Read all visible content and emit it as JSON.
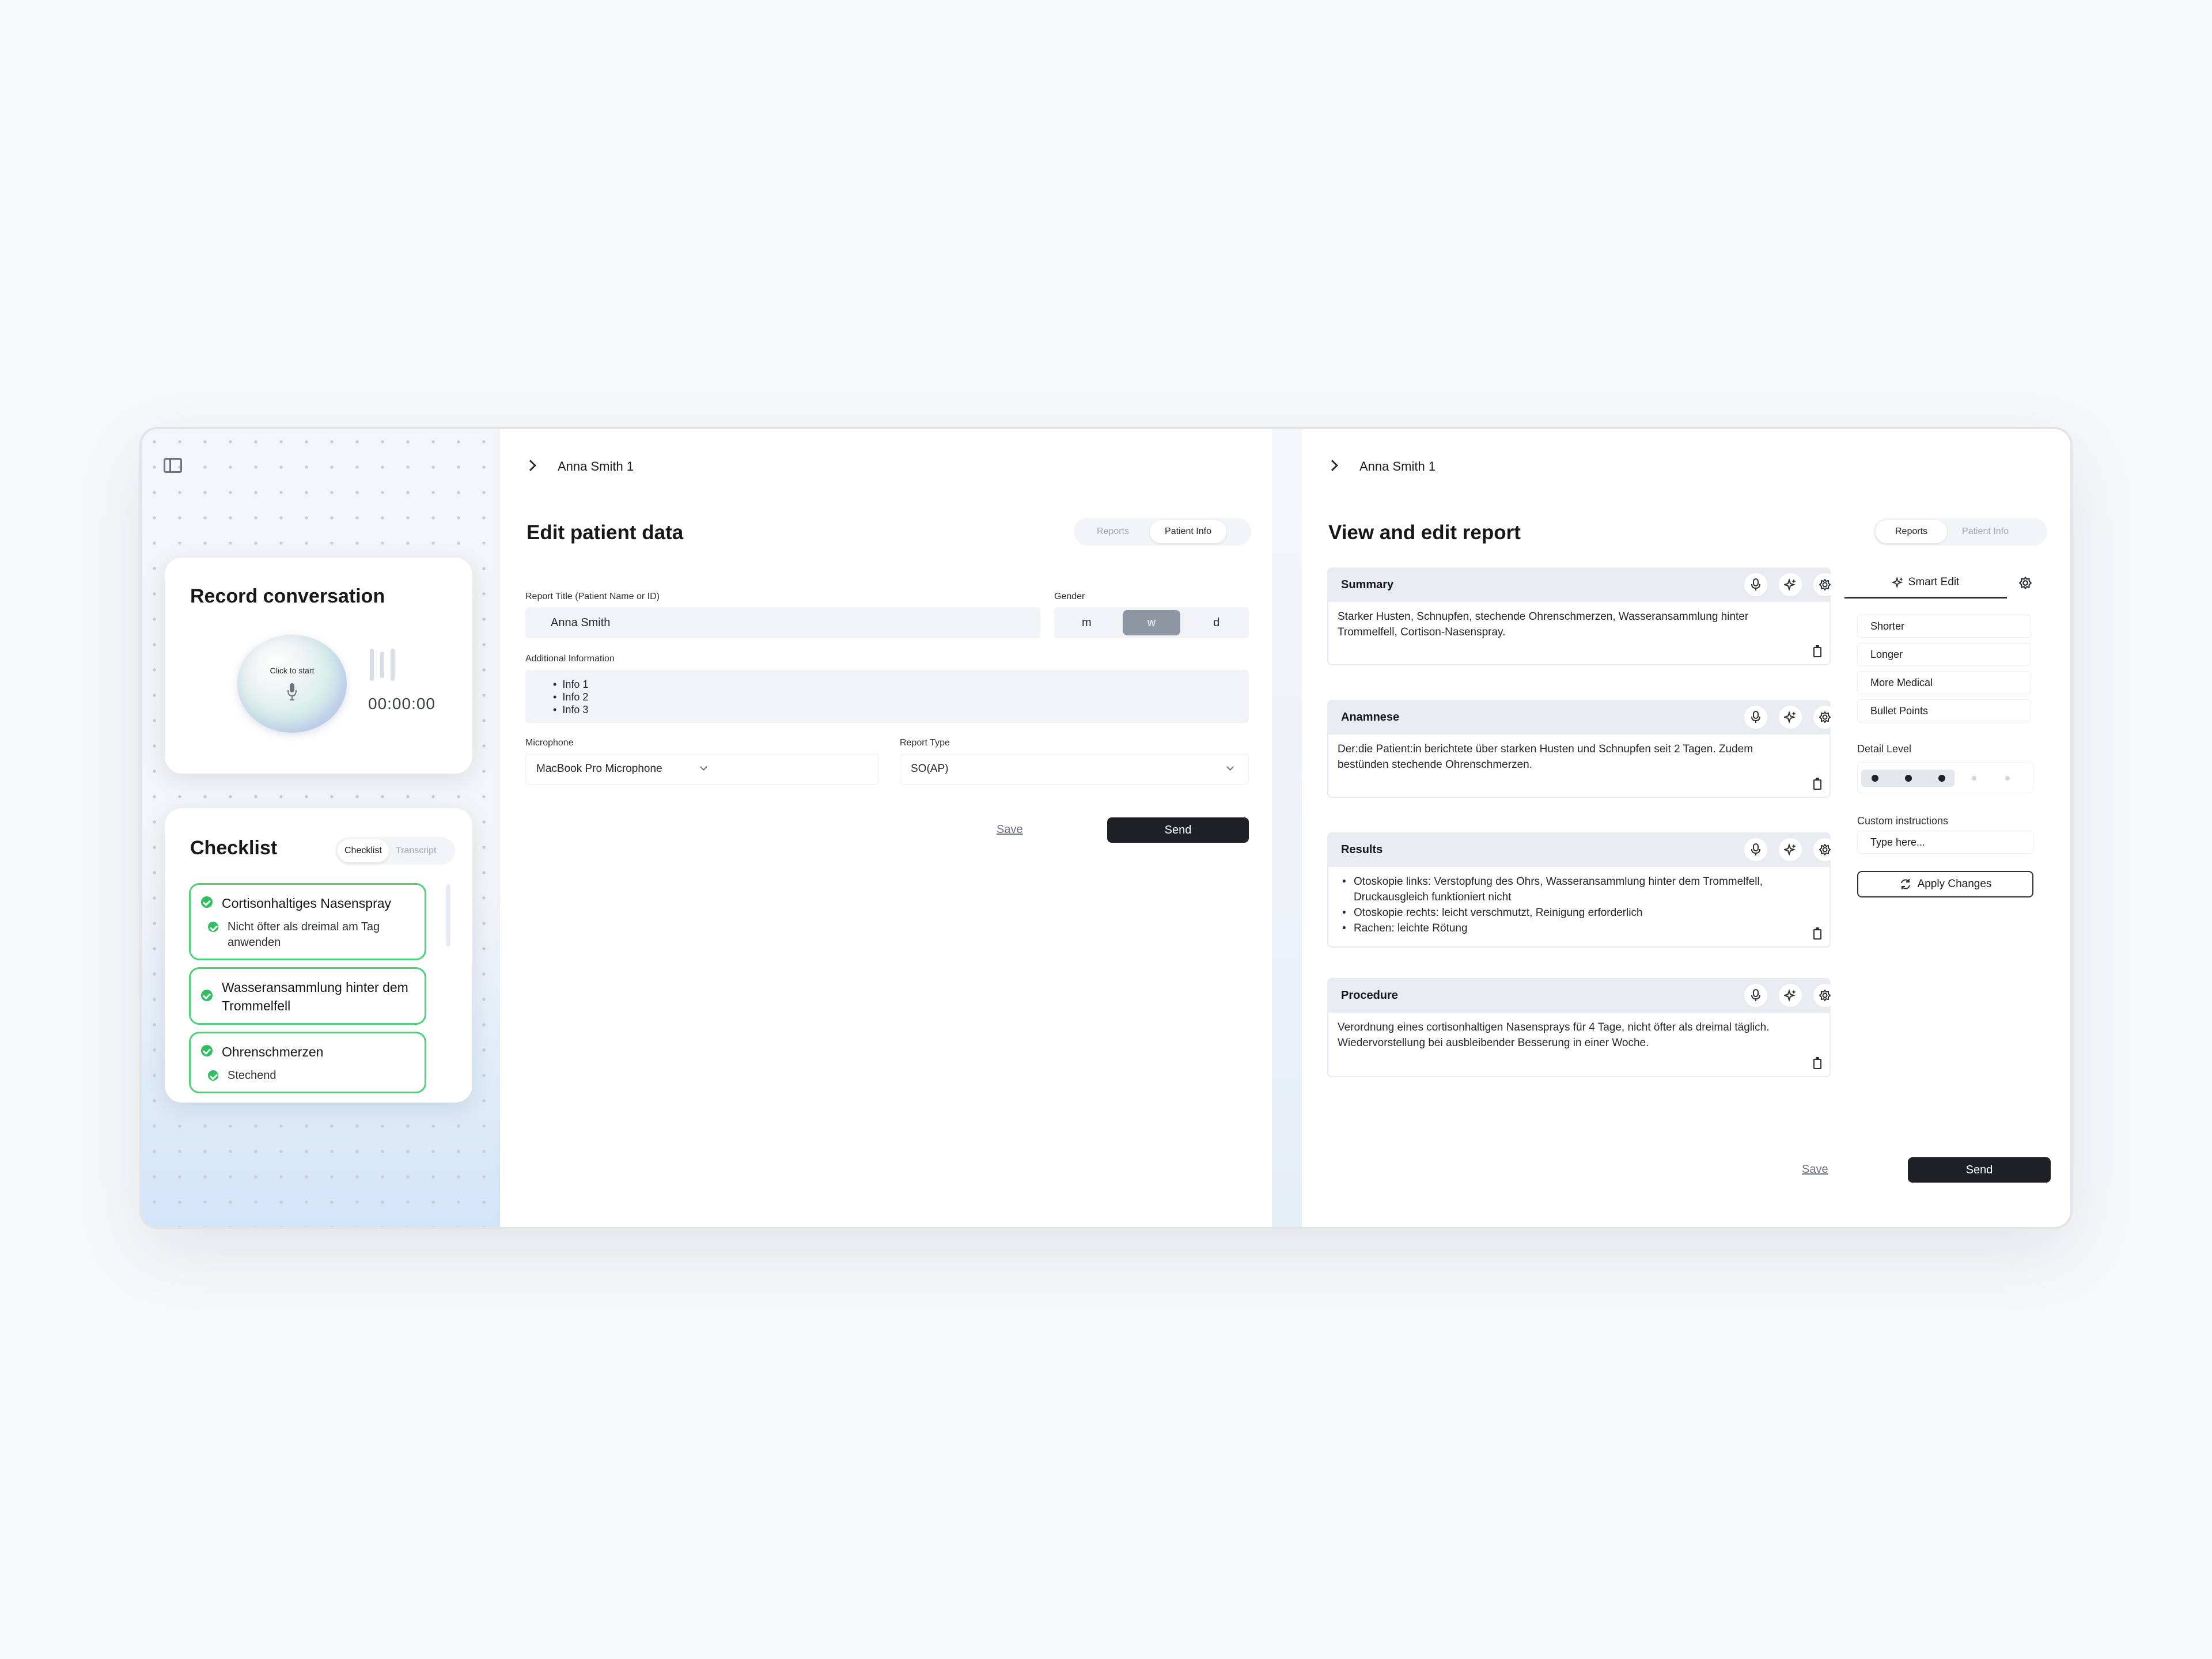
{
  "record": {
    "title": "Record conversation",
    "orb_label": "Click to start",
    "timer": "00:00:00"
  },
  "checklist": {
    "title": "Checklist",
    "tabs": [
      "Checklist",
      "Transcript"
    ],
    "active_tab": "Checklist",
    "items": [
      {
        "label": "Cortisonhaltiges Nasenspray",
        "sub": "Nicht öfter als dreimal am Tag anwenden"
      },
      {
        "label": "Wasseransammlung hinter dem Trommelfell",
        "sub": ""
      },
      {
        "label": "Ohrenschmerzen",
        "sub": "Stechend"
      }
    ]
  },
  "edit": {
    "breadcrumb": "Anna Smith 1",
    "title": "Edit patient data",
    "tabs": [
      "Reports",
      "Patient Info"
    ],
    "active_tab": "Patient Info",
    "report_title_label": "Report Title (Patient Name or ID)",
    "report_title_value": "Anna Smith",
    "gender_label": "Gender",
    "gender_options": [
      "m",
      "w",
      "d"
    ],
    "gender_selected": "w",
    "additional_label": "Additional Information",
    "additional_items": [
      "Info 1",
      "Info 2",
      "Info 3"
    ],
    "microphone_label": "Microphone",
    "microphone_value": "MacBook Pro Microphone",
    "report_type_label": "Report Type",
    "report_type_value": "SO(AP)",
    "save_label": "Save",
    "send_label": "Send"
  },
  "report": {
    "breadcrumb": "Anna Smith 1",
    "title": "View and edit report",
    "tabs": [
      "Reports",
      "Patient Info"
    ],
    "active_tab": "Reports",
    "sections": [
      {
        "title": "Summary",
        "text": "Starker Husten, Schnupfen, stechende Ohrenschmerzen, Wasseransammlung hinter Trommelfell, Cortison-Nasenspray."
      },
      {
        "title": "Anamnese",
        "text": "Der:die Patient:in berichtete über starken Husten und Schnupfen seit 2 Tagen. Zudem bestünden stechende Ohrenschmerzen."
      },
      {
        "title": "Results",
        "items": [
          "Otoskopie links: Verstopfung des Ohrs, Wasseransammlung hinter dem Trommelfell, Druckausgleich funktioniert nicht",
          "Otoskopie rechts: leicht verschmutzt, Reinigung erforderlich",
          "Rachen: leichte Rötung"
        ]
      },
      {
        "title": "Procedure",
        "text": "Verordnung eines cortisonhaltigen Nasensprays für 4 Tage, nicht öfter als dreimal täglich. Wiedervorstellung bei ausbleibender Besserung in einer Woche."
      }
    ],
    "smart_edit_label": "Smart Edit",
    "options": [
      "Shorter",
      "Longer",
      "More Medical",
      "Bullet Points"
    ],
    "detail_level_label": "Detail Level",
    "detail_level": {
      "value": 3,
      "max": 5
    },
    "custom_label": "Custom instructions",
    "custom_placeholder": "Type here...",
    "apply_label": "Apply Changes",
    "save_label": "Save",
    "send_label": "Send"
  },
  "colors": {
    "accent_dark": "#1e2026",
    "check_green": "#2fbf60",
    "check_border": "#4fcf78",
    "section_header": "#e8ecf2"
  },
  "icons": [
    "sidebar-toggle-icon",
    "microphone-icon",
    "chevron-right-icon",
    "chevron-down-icon",
    "sparkle-icon",
    "cog-icon",
    "clipboard-icon",
    "refresh-icon",
    "check-icon"
  ]
}
